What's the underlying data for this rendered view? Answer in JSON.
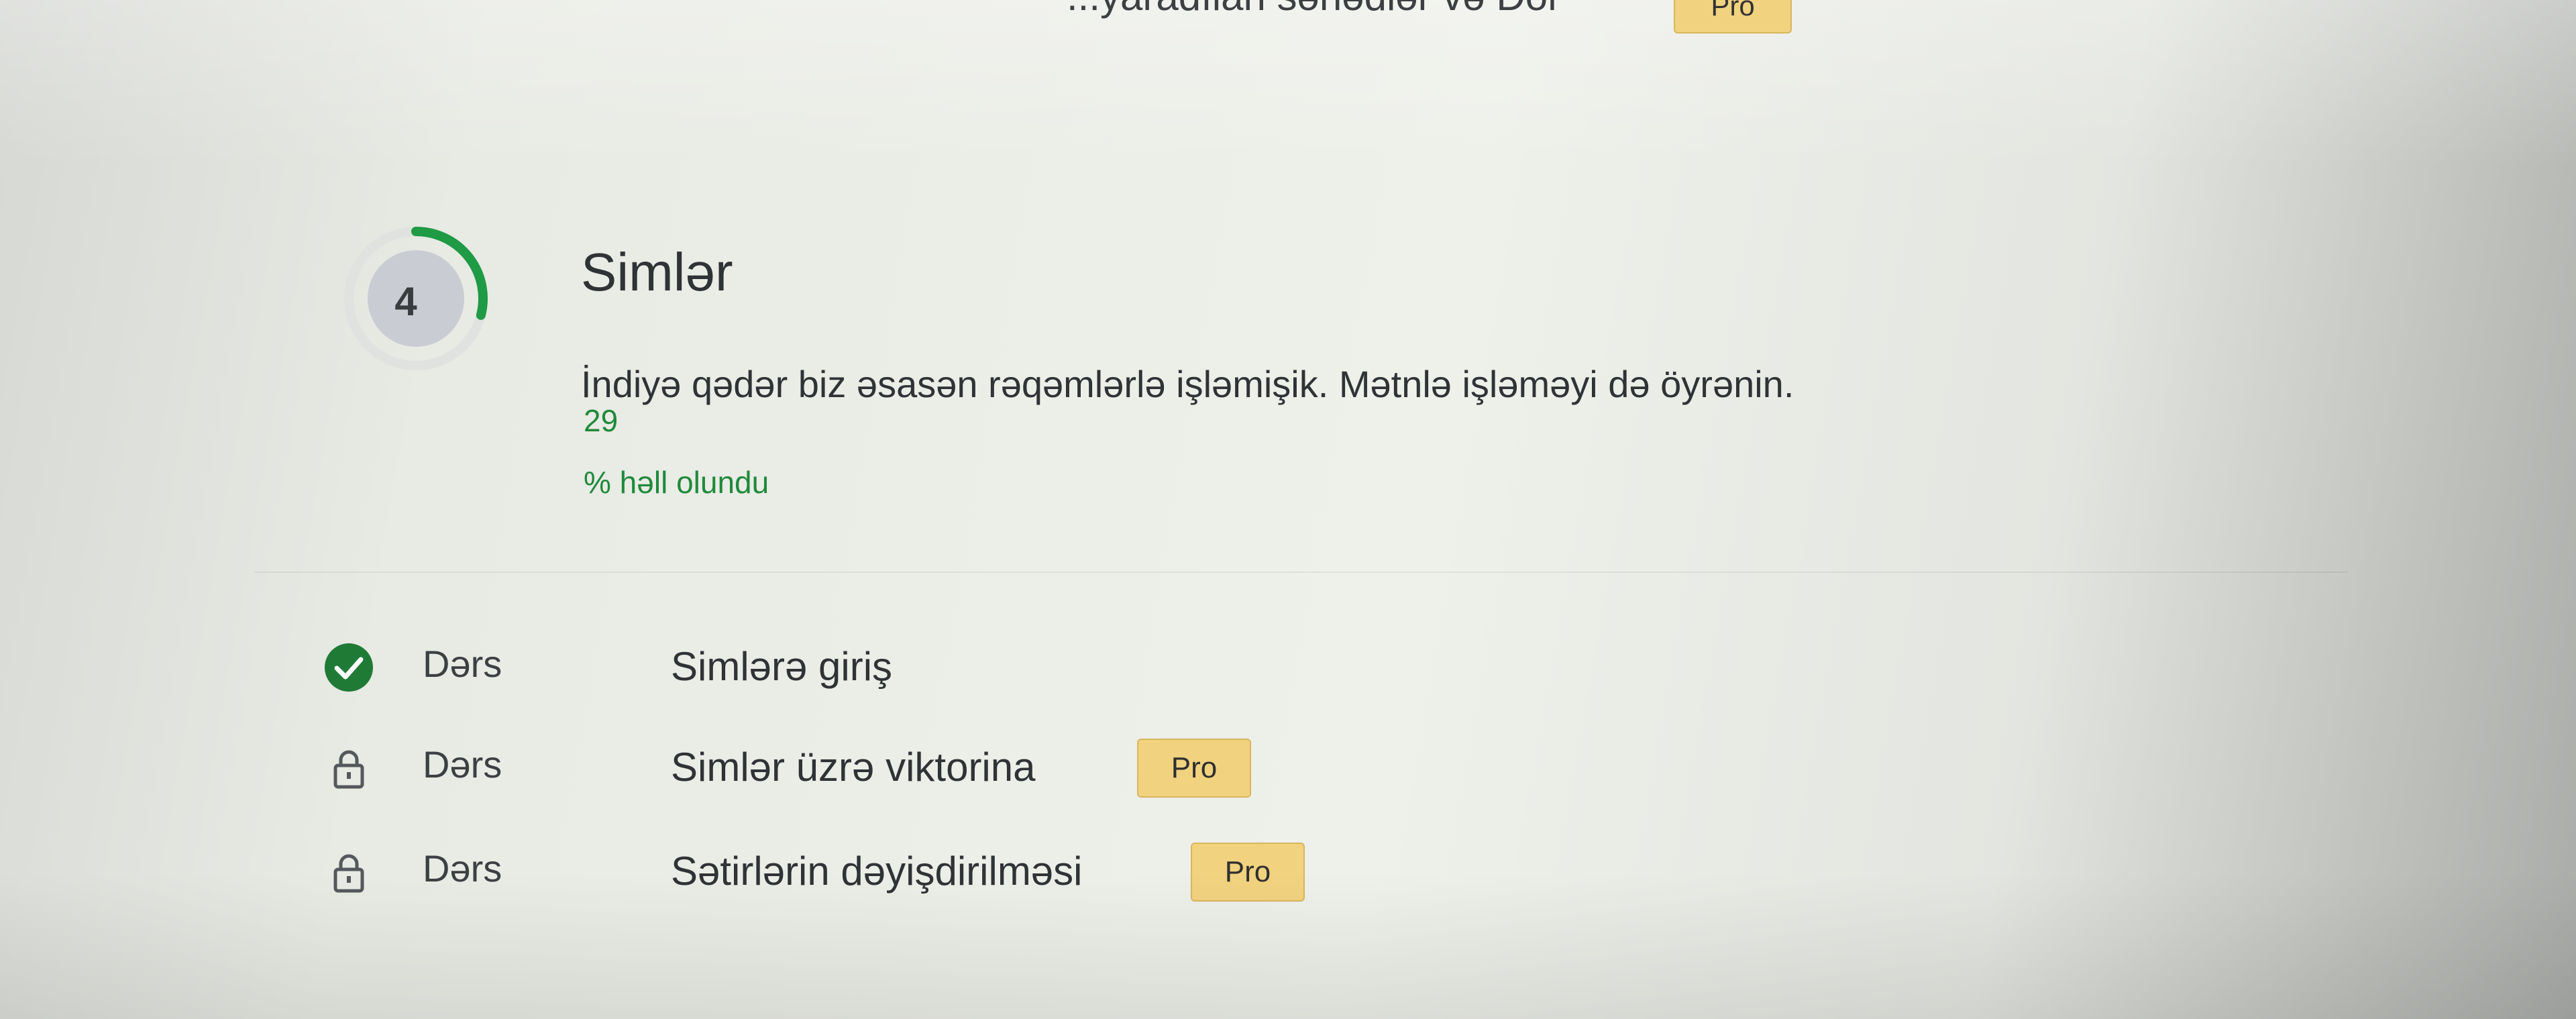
{
  "previous_section": {
    "title": "...yaradılan sənədlər və Dör",
    "pro_label": "Pro"
  },
  "chapter": {
    "number": "4",
    "title": "Simlər",
    "description": "İndiyə qədər biz əsasən rəqəmlərlə işləmişik. Mətnlə işləməyi də öyrənin.",
    "progress_value": "29",
    "progress_suffix": "% həll olundu",
    "progress_percent": 29,
    "colors": {
      "progress_arc": "#1f9a45",
      "progress_track": "#dfe2de",
      "number_circle": "#c9ccd2",
      "success": "#1f8a3b",
      "pro_badge": "#f1d27f"
    }
  },
  "lessons": [
    {
      "type": "Dərs",
      "title": "Simlərə giriş",
      "status": "completed",
      "icon": "check-circle-icon",
      "pro": false,
      "pro_label": ""
    },
    {
      "type": "Dərs",
      "title": "Simlər üzrə viktorina",
      "status": "locked",
      "icon": "lock-icon",
      "pro": true,
      "pro_label": "Pro"
    },
    {
      "type": "Dərs",
      "title": "Sətirlərin dəyişdirilməsi",
      "status": "locked",
      "icon": "lock-icon",
      "pro": true,
      "pro_label": "Pro"
    }
  ]
}
